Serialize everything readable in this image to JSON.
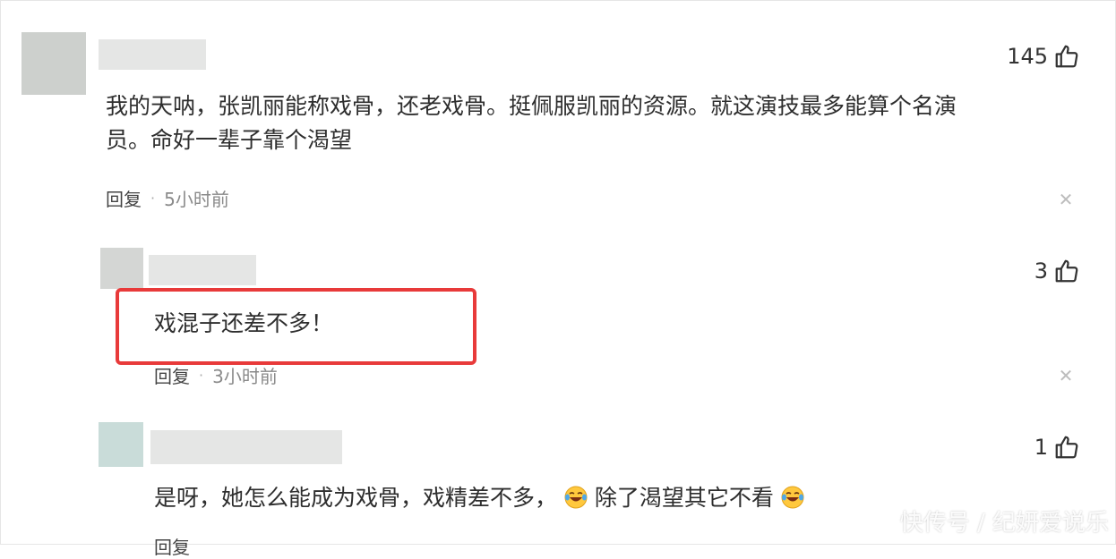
{
  "comments": [
    {
      "likes": "145",
      "text_line1": "我的天呐，张凯丽能称戏骨，还老戏骨。挺佩服凯丽的资源。就这演技最多能算个名演",
      "text_line2": "员。命好一辈子靠个渴望",
      "reply_label": "回复",
      "time": "5小时前"
    },
    {
      "likes": "3",
      "text": "戏混子还差不多！",
      "reply_label": "回复",
      "time": "3小时前"
    },
    {
      "likes": "1",
      "text_before": "是呀，她怎么能成为戏骨，戏精差不多，",
      "text_after": "除了渴望其它不看",
      "emoji": "laugh-cry-emoji",
      "reply_label": "回复"
    }
  ],
  "icons": {
    "like": "thumbs-up-icon",
    "close": "close-icon"
  },
  "colors": {
    "highlight": "#e83a3a",
    "avatar": "#cfd2cf",
    "avatar_teal": "#c9dcd9"
  },
  "watermark": "快传号 / 纪妍爱说乐"
}
